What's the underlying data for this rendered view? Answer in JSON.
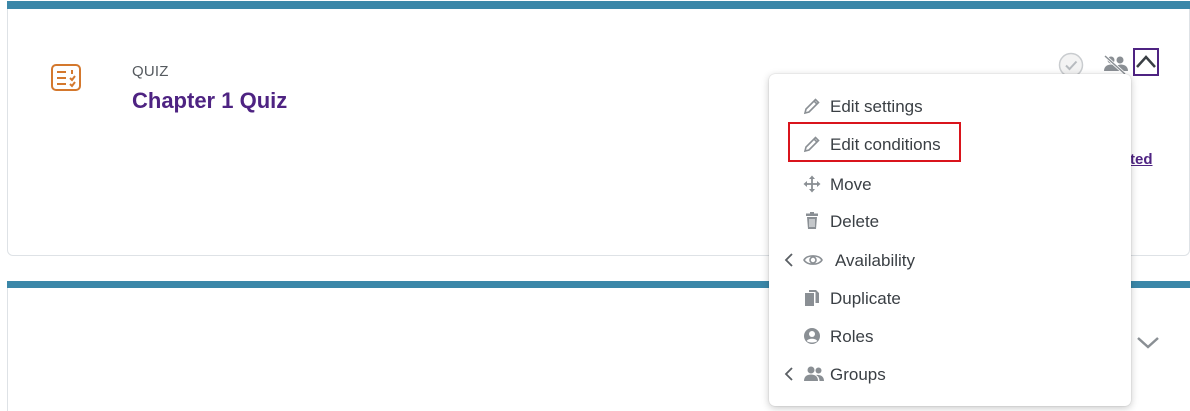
{
  "activity": {
    "type_label": "QUIZ",
    "name": "Chapter 1 Quiz",
    "partial_link_text": "ted",
    "icon": "quiz-icon"
  },
  "icons": {
    "completion": "check-circle-icon",
    "group_mode": "group-mode-icon",
    "collapse": "chevron-up-icon",
    "expand": "chevron-down-icon"
  },
  "menu": {
    "items": [
      {
        "label": "Edit settings",
        "icon": "pencil-icon"
      },
      {
        "label": "Edit conditions",
        "icon": "pencil-icon",
        "highlighted": true
      },
      {
        "label": "Move",
        "icon": "move-arrows-icon"
      },
      {
        "label": "Delete",
        "icon": "trash-icon"
      },
      {
        "label": "Availability",
        "icon": "eye-icon",
        "submenu": true
      },
      {
        "label": "Duplicate",
        "icon": "copy-icon"
      },
      {
        "label": "Roles",
        "icon": "user-circle-icon"
      },
      {
        "label": "Groups",
        "icon": "users-icon",
        "submenu": true
      }
    ]
  },
  "colors": {
    "accent_bar": "#3b87a8",
    "link": "#4e2382",
    "quiz_icon": "#d4782d",
    "highlight": "#d9141c",
    "menu_icon": "#8a8f94"
  }
}
